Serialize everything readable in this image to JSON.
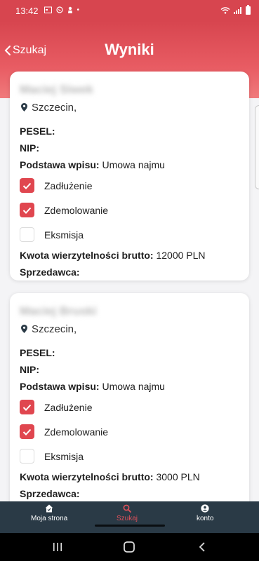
{
  "status_bar": {
    "time": "13:42",
    "dot": "•",
    "icons": [
      "calendar-icon",
      "whatsapp-icon",
      "person-icon",
      "wifi-icon",
      "signal-icon",
      "battery-icon"
    ]
  },
  "header": {
    "back_label": "Szukaj",
    "title": "Wyniki",
    "color": "#d7454f"
  },
  "labels": {
    "pesel": "PESEL:",
    "nip": "NIP:",
    "podstawa": "Podstawa wpisu:",
    "kwota": "Kwota wierzytelności brutto:",
    "sprzedawca": "Sprzedawca:"
  },
  "results": [
    {
      "name": "Maciej Siwek",
      "city": "Szczecin,",
      "pesel": "",
      "nip": "",
      "podstawa": "Umowa najmu",
      "checks": [
        {
          "label": "Zadłużenie",
          "checked": true
        },
        {
          "label": "Zdemolowanie",
          "checked": true
        },
        {
          "label": "Eksmisja",
          "checked": false
        }
      ],
      "kwota": "12000 PLN",
      "sprzedawca": ""
    },
    {
      "name": "Maciej Bruski",
      "city": "Szczecin,",
      "pesel": "",
      "nip": "",
      "podstawa": "Umowa najmu",
      "checks": [
        {
          "label": "Zadłużenie",
          "checked": true
        },
        {
          "label": "Zdemolowanie",
          "checked": true
        },
        {
          "label": "Eksmisja",
          "checked": false
        }
      ],
      "kwota": "3000 PLN",
      "sprzedawca": ""
    }
  ],
  "bottom_nav": {
    "items": [
      {
        "label": "Moja strona",
        "icon": "home-icon"
      },
      {
        "label": "Szukaj",
        "icon": "search-icon",
        "active": true
      },
      {
        "label": "konto",
        "icon": "account-icon"
      }
    ]
  },
  "colors": {
    "accent": "#e0464f",
    "nav_bg": "#2a3a46"
  }
}
